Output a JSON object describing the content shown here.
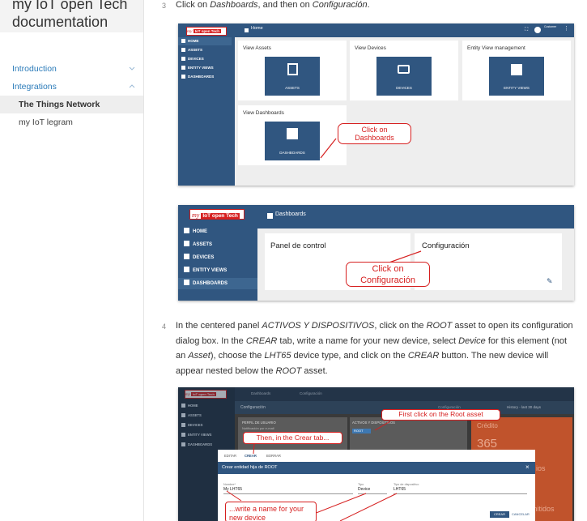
{
  "sidebar": {
    "title_line1": "my IoT open Tech",
    "title_line2": "documentation",
    "items": [
      {
        "label": "Introduction"
      },
      {
        "label": "Integrations"
      }
    ],
    "subitems": [
      {
        "label": "The Things Network",
        "active": true
      },
      {
        "label": "my IoT legram",
        "active": false
      }
    ]
  },
  "steps": {
    "step3": {
      "number": "3",
      "text_1": "Click on ",
      "em_1": "Dashboards",
      "text_2": ", and then on ",
      "em_2": "Configuración",
      "text_3": "."
    },
    "step4": {
      "number": "4",
      "t1": "In the centered panel ",
      "e1": "ACTIVOS Y DISPOSITIVOS",
      "t2": ", click on the ",
      "e2": "ROOT",
      "t3": " asset to open its configuration dialog box. In the ",
      "e3": "CREAR",
      "t4": " tab, write a name for your new device, select ",
      "e4": "Device",
      "t5": " for this element (not an ",
      "e5": "Asset",
      "t6": "), choose the ",
      "e6": "LHT65",
      "t7": " device type, and click on the ",
      "e7": "CREAR",
      "t8": " button. The new device will appear nested below the ",
      "e8": "ROOT",
      "t9": " asset."
    }
  },
  "shot1": {
    "logo_script": "my",
    "logo_text": "IoT open Tech",
    "breadcrumb": "Home",
    "user": "Customer",
    "nav": [
      "HOME",
      "ASSETS",
      "DEVICES",
      "ENTITY VIEWS",
      "DASHBOARDS"
    ],
    "cards": [
      {
        "title": "View Assets",
        "tile": "ASSETS"
      },
      {
        "title": "View Devices",
        "tile": "DEVICES"
      },
      {
        "title": "Entity View management",
        "tile": "ENTITY VIEWS"
      },
      {
        "title": "View Dashboards",
        "tile": "DASHBOARDS"
      }
    ],
    "callout_line1": "Click on",
    "callout_line2": "Dashboards"
  },
  "shot2": {
    "logo_script": "my",
    "logo_text": "IoT open Tech",
    "header": "Dashboards",
    "nav": [
      "HOME",
      "ASSETS",
      "DEVICES",
      "ENTITY VIEWS",
      "DASHBOARDS"
    ],
    "card1": "Panel de control",
    "card2": "Configuración",
    "callout_line1": "Click on",
    "callout_line2": "Configuración"
  },
  "shot3": {
    "breadcrumb_1": "Dashboards",
    "breadcrumb_2": "Configuración",
    "panel_title": "Configuración",
    "nav": [
      "HOME",
      "ASSETS",
      "DEVICES",
      "ENTITY VIEWS",
      "DASHBOARDS"
    ],
    "history": "History - last 30 days",
    "panel1": "PERFIL DE USUARIO",
    "panel1_sub": "Notificación por e-mail",
    "panel2": "ACTIVOS Y DISPOSITIVOS",
    "root_chip": "ROOT",
    "credit": "Crédito",
    "credit_value": "365",
    "callout_first": "First click on the Root asset",
    "callout_crear": "Then, in the Crear tab...",
    "callout_write_1": "...write a name for your",
    "callout_write_2": "new device",
    "tabs": [
      "EDITAR",
      "CREAR",
      "BORRAR"
    ],
    "dialog_title": "Crear entidad hija de ROOT",
    "name_label": "Nombre*",
    "name_value": "My LHT65",
    "type_label": "Tipo",
    "type_value": "Device",
    "devtype_label": "Tipo de dispositivo",
    "devtype_value": "LHT65",
    "btn_crear": "CREAR",
    "btn_cancel": "CANCELAR",
    "orange_1": "ios",
    "orange_2": "mitidos"
  }
}
